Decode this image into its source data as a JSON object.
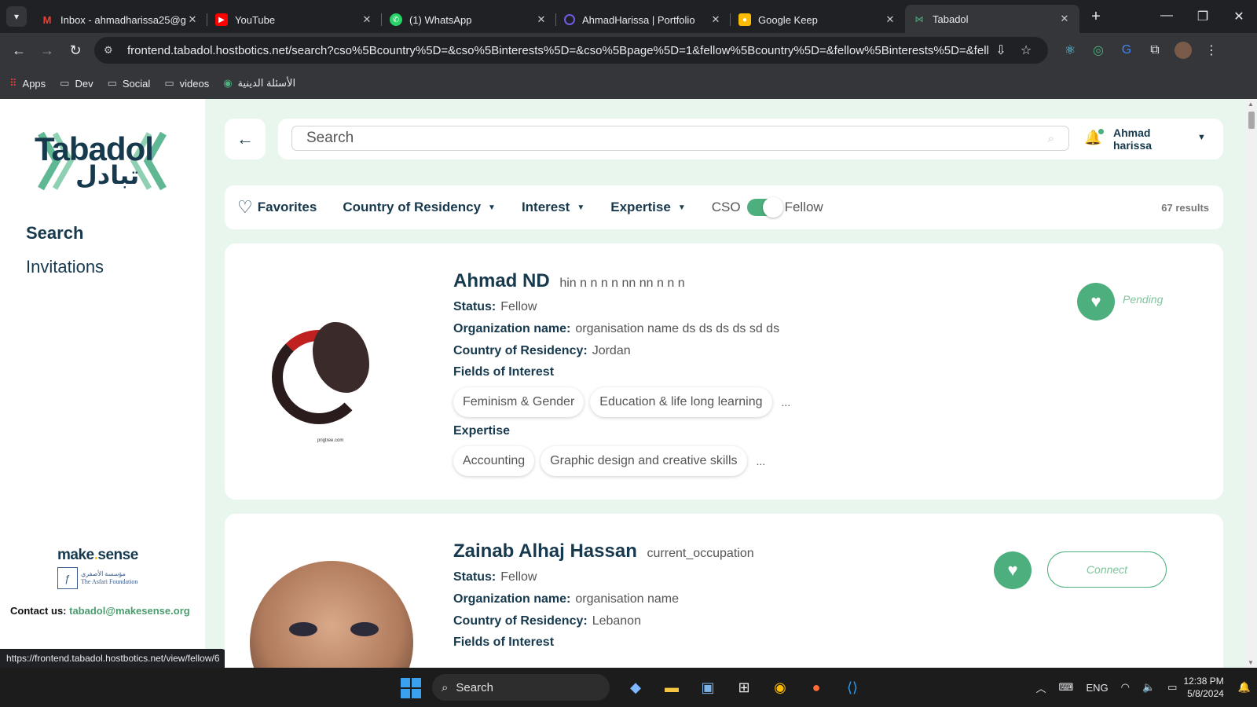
{
  "browser": {
    "tabs": [
      {
        "title": "Inbox - ahmadharissa25@g",
        "icon": "gmail-icon",
        "color": "#ea4335"
      },
      {
        "title": "YouTube",
        "icon": "youtube-icon",
        "color": "#ff0000"
      },
      {
        "title": "(1) WhatsApp",
        "icon": "whatsapp-icon",
        "color": "#25d366"
      },
      {
        "title": "AhmadHarissa | Portfolio",
        "icon": "portfolio-icon",
        "color": "#6c5ce7"
      },
      {
        "title": "Google Keep",
        "icon": "keep-icon",
        "color": "#fbbc04"
      },
      {
        "title": "Tabadol",
        "icon": "tabadol-icon",
        "color": "#4caf7d"
      }
    ],
    "active_tab_index": 5,
    "url": "frontend.tabadol.hostbotics.net/search?cso%5Bcountry%5D=&cso%5Binterests%5D=&cso%5Bpage%5D=1&fellow%5Bcountry%5D=&fellow%5Binterests%5D=&fellow%...",
    "bookmarks": [
      {
        "label": "Apps",
        "icon": "apps-grid-icon"
      },
      {
        "label": "Dev",
        "icon": "folder-icon"
      },
      {
        "label": "Social",
        "icon": "folder-icon"
      },
      {
        "label": "videos",
        "icon": "folder-icon"
      },
      {
        "label": "الأسئلة الدينية",
        "icon": "site-icon"
      }
    ],
    "status_url": "https://frontend.tabadol.hostbotics.net/view/fellow/6"
  },
  "sidebar": {
    "logo_latin": "Tabadol",
    "logo_arabic": "تبادل",
    "nav": [
      {
        "label": "Search",
        "active": true
      },
      {
        "label": "Invitations",
        "active": false
      }
    ],
    "brand_make": "make",
    "brand_sense": "sense",
    "brand_foundation_ar": "مؤسسة الأصفري",
    "brand_foundation_en": "The Asfari Foundation",
    "contact_label": "Contact us:",
    "contact_email": "tabadol@makesense.org"
  },
  "header": {
    "search_placeholder": "Search",
    "search_value": "",
    "user_first": "Ahmad",
    "user_last": "harissa"
  },
  "filters": {
    "favorites": "Favorites",
    "country": "Country of Residency",
    "interest": "Interest",
    "expertise": "Expertise",
    "toggle_left": "CSO",
    "toggle_right": "Fellow",
    "results": "67 results"
  },
  "labels": {
    "status": "Status:",
    "org": "Organization name:",
    "country": "Country of Residency:",
    "interests": "Fields of Interest",
    "expertise": "Expertise"
  },
  "profiles": [
    {
      "name": "Ahmad ND",
      "occupation": "hin n n n n nn nn n n n",
      "status": "Fellow",
      "organization": "organisation name ds ds ds ds sd ds",
      "country": "Jordan",
      "interests": [
        "Feminism & Gender",
        "Education & life long learning"
      ],
      "expertise": [
        "Accounting",
        "Graphic design and creative skills"
      ],
      "more": "...",
      "action": "Pending",
      "photo_caption": "pngtree.com"
    },
    {
      "name": "Zainab Alhaj Hassan",
      "occupation": "current_occupation",
      "status": "Fellow",
      "organization": "organisation name",
      "country": "Lebanon",
      "action": "Connect"
    }
  ],
  "taskbar": {
    "search": "Search",
    "language": "ENG",
    "time": "12:38 PM",
    "date": "5/8/2024"
  },
  "colors": {
    "brand_navy": "#17394e",
    "brand_green": "#4caf7d",
    "page_bg": "#e9f6ee"
  }
}
